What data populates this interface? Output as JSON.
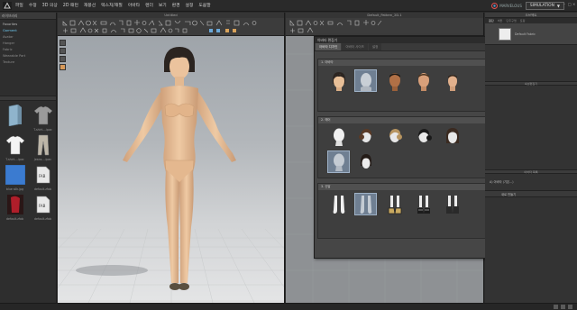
{
  "menu": {
    "items": [
      "파일",
      "수정",
      "3D 의상",
      "2D 패턴",
      "재봉선",
      "텍스처/재질",
      "아바타",
      "렌더",
      "보기",
      "환경",
      "설정",
      "도움말"
    ],
    "brand_text": "MARVELOUS",
    "simulation_label": "SIMULATION"
  },
  "library": {
    "tab_label": "라이브러리",
    "tree": [
      "Favorites",
      "Garment",
      "Avatar",
      "Hanger",
      "Fabric",
      "Wearable Part",
      "Texture"
    ],
    "active_index": 1,
    "thumbnails": [
      {
        "label": "",
        "icon": "folder-icon"
      },
      {
        "label": "T-shirt....ipac",
        "icon": "tshirt-icon"
      },
      {
        "label": "T-shirt....ipac",
        "icon": "tshirt-white-icon"
      },
      {
        "label": "Jeans....ipac",
        "icon": "jeans-icon"
      },
      {
        "label": "blue silk.jpg",
        "icon": "blue-fabric-icon"
      },
      {
        "label": "default.zfab",
        "icon": "fabric-file-icon"
      },
      {
        "label": "default.zfab",
        "icon": "red-fabric-icon"
      },
      {
        "label": "default.zfab",
        "icon": "fabric-file-icon"
      }
    ]
  },
  "viewport3d": {
    "title": "Untitled"
  },
  "viewport2d": {
    "title": "Default_Pattern_2D.1"
  },
  "dialog": {
    "title": "아바타 편집기",
    "tabs": [
      "아바타 디자인",
      "아바타 사이즈",
      "설정"
    ],
    "active_tab": 0,
    "sections": [
      {
        "title": "1. 아바타",
        "items": [
          "avatar-face-1",
          "avatar-face-2",
          "avatar-face-3",
          "avatar-face-4",
          "avatar-face-5"
        ],
        "selected": 1
      },
      {
        "title": "2. 헤어",
        "items": [
          "hair-bald",
          "hair-bun",
          "hair-blonde-updo",
          "hair-black-updo",
          "hair-dark-long",
          "hair-bald-selected",
          "hair-dark-bob"
        ],
        "selected": 5
      },
      {
        "title": "3. 신발",
        "items": [
          "feet-bare",
          "feet-bare-selected",
          "shoes-sandal-1",
          "shoes-sandal-2",
          "shoes-sneaker"
        ],
        "selected": 1
      }
    ]
  },
  "right_panel": {
    "header": "오브젝트",
    "tabs": [
      "원단",
      "버튼",
      "단추구멍",
      "토핑"
    ],
    "fabric_label": "Default Fabric",
    "property_header": "속성편집기",
    "attach_header": "아바타 목록",
    "attach_item": "A) 아바타 (기본...)",
    "add_label": "새로 만들기"
  },
  "colors": {
    "accent": "#6cc6ee",
    "dialog_selected": "#6f7f92",
    "skin": "#e8c39f"
  }
}
